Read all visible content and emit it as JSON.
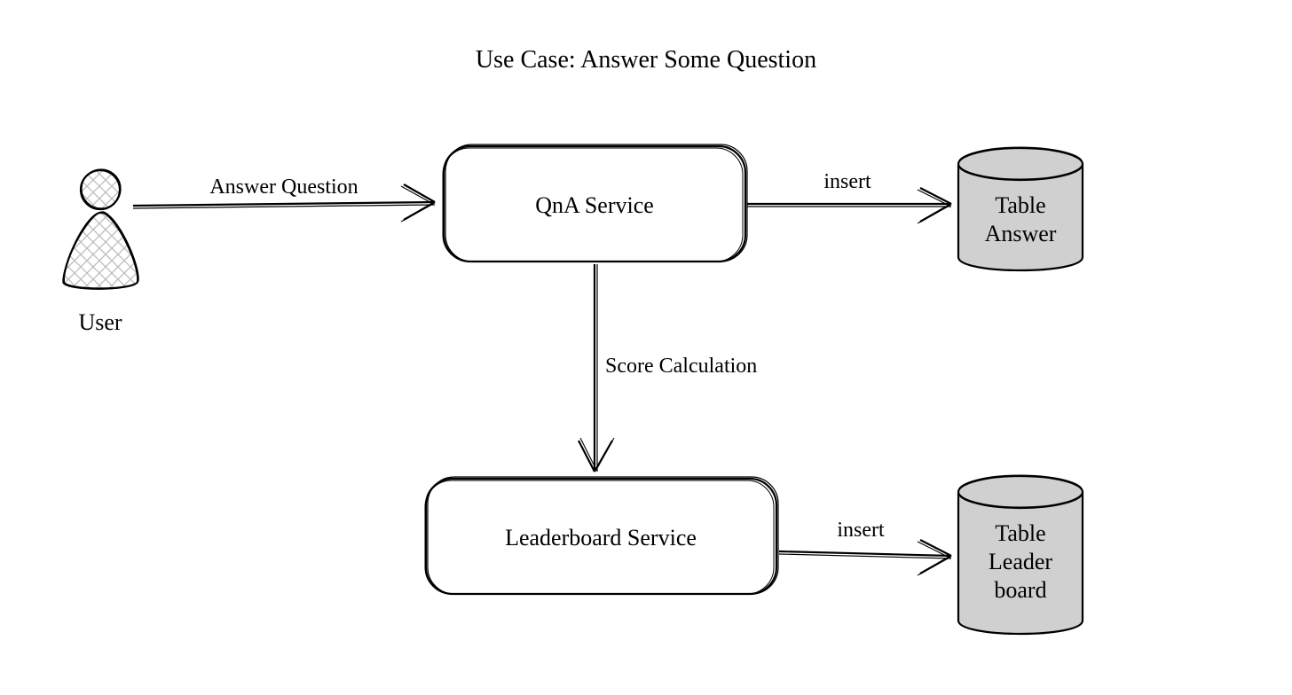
{
  "title": "Use Case: Answer Some Question",
  "actors": {
    "user": {
      "label": "User"
    }
  },
  "services": {
    "qna": {
      "label": "QnA Service"
    },
    "leaderboard": {
      "label": "Leaderboard Service"
    }
  },
  "datastores": {
    "answer": {
      "line1": "Table",
      "line2": "Answer"
    },
    "leaderboard": {
      "line1": "Table",
      "line2": "Leader",
      "line3": "board"
    }
  },
  "edges": {
    "user_to_qna": {
      "label": "Answer Question"
    },
    "qna_to_answer": {
      "label": "insert"
    },
    "qna_to_leaderboard": {
      "label": "Score Calculation"
    },
    "leaderboard_to_table": {
      "label": "insert"
    }
  }
}
